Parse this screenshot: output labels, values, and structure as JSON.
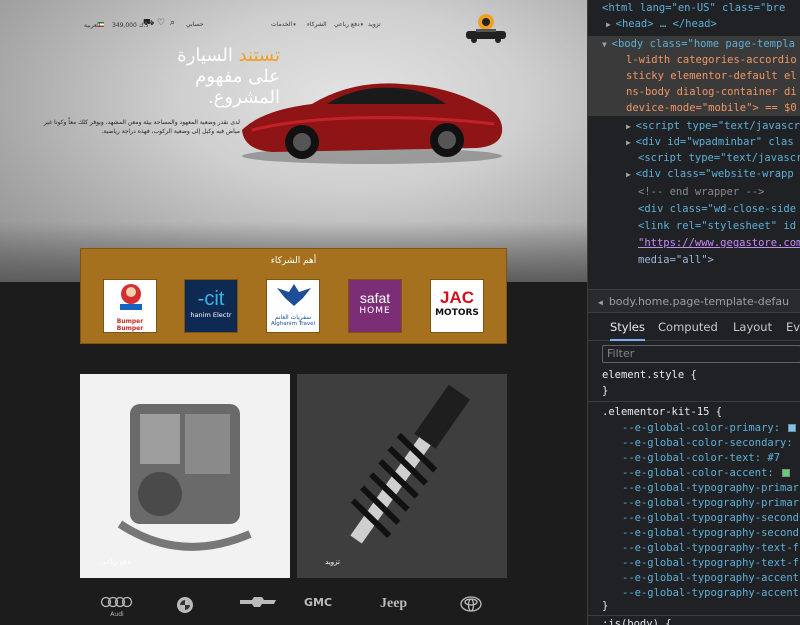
{
  "site": {
    "nav": {
      "items": [
        "تزويد",
        "دفع رباعي",
        "الشركاء",
        "الخدمات",
        "دعم"
      ],
      "account": "حسابي",
      "cart_amount": "349,000 د.ك",
      "lang": "العربية"
    },
    "hero": {
      "headline_accent": "تستند",
      "headline_rest": "السيارة",
      "headline_line2": "على مفهوم",
      "headline_line3": "المشروع.",
      "lead": "لدى نقدر وضعية المعهود والمساحة بيئة ومعن المشهد، ويوفر كلك معاً وكونا غير مياض فيه وكيل إلى وضعية الركوب، فهذه دراجة رياضية."
    },
    "partners": {
      "title": "أهم الشركاء",
      "logos": [
        {
          "name": "JAC MOTORS",
          "line1": "JAC",
          "line2": "MOTORS"
        },
        {
          "name": "safat HOME",
          "line1": "safat",
          "line2": "HOME"
        },
        {
          "name": "Alghanim Travel",
          "line1": "سفريات الغانم",
          "line2": "Alghanim Travel"
        },
        {
          "name": "X-cite",
          "line1": "-cit",
          "line2": "hanim Electr"
        },
        {
          "name": "Bumper to Bumper",
          "line1": "Bumper",
          "line2": "Bumper"
        }
      ]
    },
    "categories": [
      {
        "label": "دفع رباعي"
      },
      {
        "label": "تزويد"
      }
    ],
    "brands": [
      "Audi",
      "",
      "GMC",
      "Jeep",
      ""
    ]
  },
  "devtools": {
    "dom_lines": [
      {
        "indent": 0,
        "html": "<html lang=\"en-US\" class=\"bre"
      },
      {
        "indent": 1,
        "html": "<head> … </head>"
      },
      {
        "indent": 0,
        "html": "<body class=\"home page-templa"
      },
      {
        "indent": 1,
        "html": "l-width categories-accordio"
      },
      {
        "indent": 1,
        "html": "sticky elementor-default el"
      },
      {
        "indent": 1,
        "html": "ns-body dialog-container di"
      },
      {
        "indent": 1,
        "html": "device-mode=\"mobile\"> == $0"
      },
      {
        "indent": 1,
        "html": "<script type=\"text/javascr"
      },
      {
        "indent": 1,
        "html": "<div id=\"wpadminbar\" clas"
      },
      {
        "indent": 1,
        "html": "<script type=\"text/javascr"
      },
      {
        "indent": 1,
        "html": "<div class=\"website-wrapp"
      },
      {
        "indent": 2,
        "html": "<!-- end wrapper -->"
      },
      {
        "indent": 2,
        "html": "<div class=\"wd-close-side"
      },
      {
        "indent": 2,
        "html": "<link rel=\"stylesheet\" id"
      },
      {
        "indent": 2,
        "html": "\"https://www.gegastore.com"
      },
      {
        "indent": 2,
        "html": "media=\"all\">"
      }
    ],
    "breadcrumb": "body.home.page-template-defau",
    "tabs": [
      "Styles",
      "Computed",
      "Layout",
      "Eve"
    ],
    "filter_placeholder": "Filter",
    "rules": [
      "element.style {",
      "}",
      ".elementor-kit-15 {",
      "--e-global-color-primary:",
      "--e-global-color-secondary:",
      "--e-global-color-text: #7",
      "--e-global-color-accent:",
      "--e-global-typography-primar",
      "--e-global-typography-primar",
      "--e-global-typography-second",
      "--e-global-typography-second",
      "--e-global-typography-text-f",
      "--e-global-typography-text-f",
      "--e-global-typography-accent",
      "--e-global-typography-accent",
      "}",
      ":is(body) {"
    ],
    "colors": {
      "primary": "#6ec6ff",
      "text_swatch": "#7a7a7a",
      "accent": "#61ce70"
    }
  }
}
